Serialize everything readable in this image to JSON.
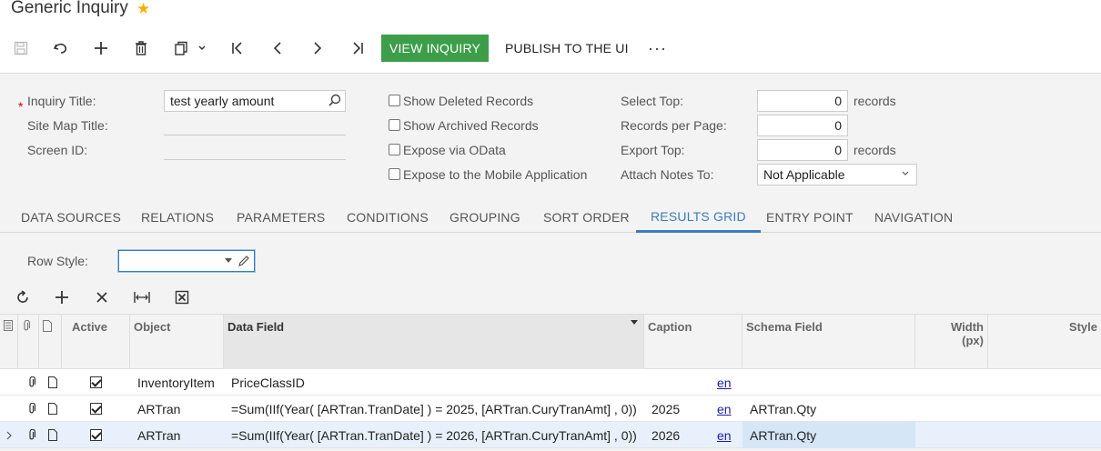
{
  "page": {
    "title": "Generic Inquiry"
  },
  "toolbar": {
    "view_inquiry": "VIEW INQUIRY",
    "publish": "PUBLISH TO THE UI",
    "more": "···"
  },
  "summary": {
    "inquiry_title_label": "Inquiry Title:",
    "inquiry_title_value": "test yearly amount",
    "site_map_title_label": "Site Map Title:",
    "screen_id_label": "Screen ID:",
    "required_mark": "*",
    "show_deleted": "Show Deleted Records",
    "show_archived": "Show Archived Records",
    "expose_odata": "Expose via OData",
    "expose_mobile": "Expose to the Mobile Application",
    "select_top_label": "Select Top:",
    "select_top_value": "0",
    "records_per_page_label": "Records per Page:",
    "records_per_page_value": "0",
    "export_top_label": "Export Top:",
    "export_top_value": "0",
    "records_suffix": "records",
    "attach_notes_label": "Attach Notes To:",
    "attach_notes_value": "Not Applicable"
  },
  "tabs": [
    {
      "label": "DATA SOURCES"
    },
    {
      "label": "RELATIONS"
    },
    {
      "label": "PARAMETERS"
    },
    {
      "label": "CONDITIONS"
    },
    {
      "label": "GROUPING"
    },
    {
      "label": "SORT ORDER"
    },
    {
      "label": "RESULTS GRID",
      "active": true
    },
    {
      "label": "ENTRY POINT"
    },
    {
      "label": "NAVIGATION"
    }
  ],
  "results_grid": {
    "row_style_label": "Row Style:",
    "columns": {
      "active": "Active",
      "object": "Object",
      "data_field": "Data Field",
      "caption": "Caption",
      "schema_field": "Schema Field",
      "width": "Width\n(px)",
      "style": "Style"
    },
    "rows": [
      {
        "active": true,
        "object": "InventoryItem",
        "data_field": "PriceClassID",
        "caption": "",
        "lang": "en",
        "schema_field": ""
      },
      {
        "active": true,
        "object": "ARTran",
        "data_field": "=Sum(IIf(Year( [ARTran.TranDate] ) = 2025, [ARTran.CuryTranAmt] , 0))",
        "caption": "2025",
        "lang": "en",
        "schema_field": "ARTran.Qty"
      },
      {
        "active": true,
        "object": "ARTran",
        "data_field": "=Sum(IIf(Year( [ARTran.TranDate] ) = 2026, [ARTran.CuryTranAmt] , 0))",
        "caption": "2026",
        "lang": "en",
        "schema_field": "ARTran.Qty",
        "selected": true
      }
    ]
  },
  "colors": {
    "primary_button": "#3d9e4a",
    "active_tab": "#3b7dbb",
    "star": "#f0b400"
  }
}
